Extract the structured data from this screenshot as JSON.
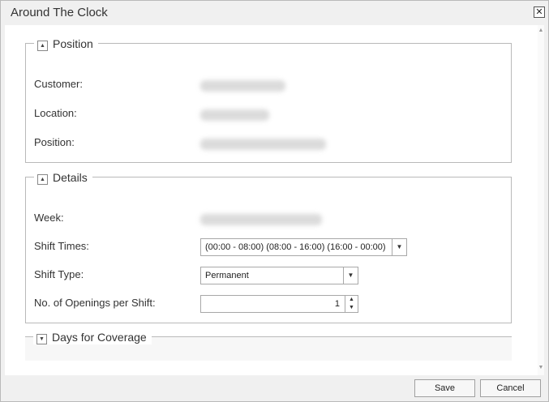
{
  "dialog": {
    "title": "Around The Clock",
    "close_glyph": "✕"
  },
  "position_section": {
    "legend": "Position",
    "toggle_glyph": "▲",
    "fields": [
      {
        "label": "Customer:"
      },
      {
        "label": "Location:"
      },
      {
        "label": "Position:"
      }
    ]
  },
  "details_section": {
    "legend": "Details",
    "toggle_glyph": "▲",
    "week_label": "Week:",
    "shift_times_label": "Shift Times:",
    "shift_times_value": "(00:00 - 08:00) (08:00 - 16:00) (16:00 - 00:00)",
    "shift_type_label": "Shift Type:",
    "shift_type_value": "Permanent",
    "openings_label": "No. of Openings per Shift:",
    "openings_value": "1",
    "dropdown_glyph": "▼",
    "spin_up_glyph": "▲",
    "spin_down_glyph": "▼"
  },
  "days_section": {
    "legend": "Days for Coverage",
    "toggle_glyph": "▼"
  },
  "scrollbar": {
    "up_glyph": "▲",
    "down_glyph": "▼"
  },
  "footer": {
    "save_label": "Save",
    "cancel_label": "Cancel"
  }
}
